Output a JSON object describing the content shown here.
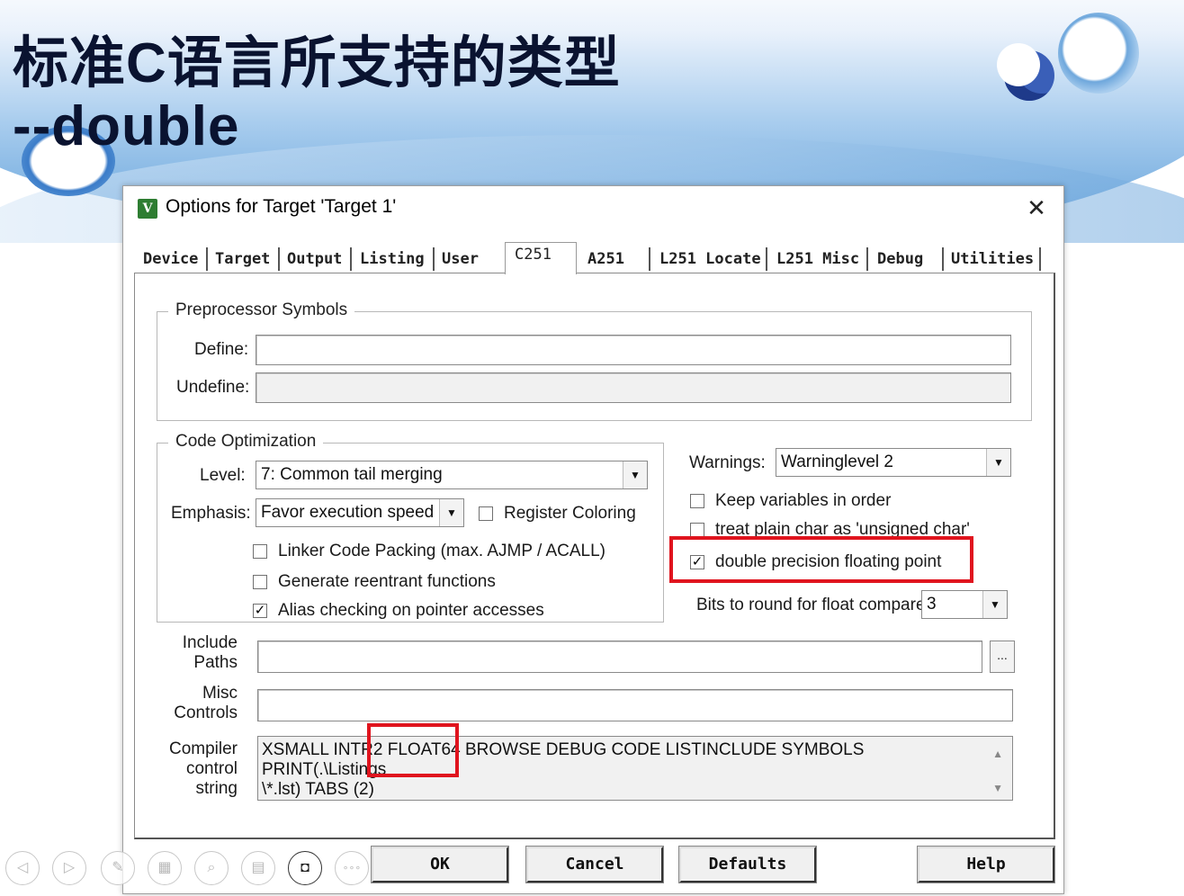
{
  "slide": {
    "title_line1": "标准C语言所支持的类型",
    "title_line2": "--double"
  },
  "dialog": {
    "title": "Options for Target 'Target 1'",
    "close_glyph": "✕",
    "tabs": [
      "Device",
      "Target",
      "Output",
      "Listing",
      "User",
      "C251",
      "A251",
      "L251 Locate",
      "L251 Misc",
      "Debug",
      "Utilities"
    ],
    "active_tab": "C251"
  },
  "preprocessor": {
    "group_title": "Preprocessor Symbols",
    "define_label": "Define:",
    "define_value": "",
    "undefine_label": "Undefine:",
    "undefine_value": ""
  },
  "optimization": {
    "group_title": "Code Optimization",
    "level_label": "Level:",
    "level_value": "7: Common tail merging",
    "emphasis_label": "Emphasis:",
    "emphasis_value": "Favor execution speed",
    "register_coloring": {
      "label": "Register Coloring",
      "checked": false
    },
    "linker_code_packing": {
      "label": "Linker Code Packing (max. AJMP / ACALL)",
      "checked": false
    },
    "reentrant": {
      "label": "Generate reentrant functions",
      "checked": false
    },
    "alias_checking": {
      "label": "Alias checking on pointer accesses",
      "checked": true
    }
  },
  "warnings": {
    "label": "Warnings:",
    "value": "Warninglevel 2",
    "keep_vars": {
      "label": "Keep variables in order",
      "checked": false
    },
    "plain_char": {
      "label": "treat plain char as 'unsigned char'",
      "checked": false
    },
    "double_precision": {
      "label": "double precision floating point",
      "checked": true
    },
    "bits_label": "Bits to round for float compare:",
    "bits_value": "3"
  },
  "paths": {
    "include_label_1": "Include",
    "include_label_2": "Paths",
    "include_value": "",
    "browse_label": "...",
    "misc_label_1": "Misc",
    "misc_label_2": "Controls",
    "misc_value": "",
    "compiler_label_1": "Compiler",
    "compiler_label_2": "control",
    "compiler_label_3": "string",
    "compiler_line1": "XSMALL INTR2 FLOAT64 BROWSE DEBUG CODE LISTINCLUDE SYMBOLS PRINT(.\\Listings",
    "compiler_line2": "\\*.lst) TABS (2)"
  },
  "buttons": {
    "ok": "OK",
    "cancel": "Cancel",
    "defaults": "Defaults",
    "help": "Help"
  },
  "ppt_toolbar": {
    "prev": "◁",
    "next": "▷",
    "pen": "✎",
    "slides": "▦",
    "zoom": "⌕",
    "subtitles": "▤",
    "camera": "◘",
    "more": "∘∘∘"
  },
  "colors": {
    "highlight": "#e0141e",
    "title_text": "#0a1330",
    "app_icon": "#2e7d32"
  }
}
